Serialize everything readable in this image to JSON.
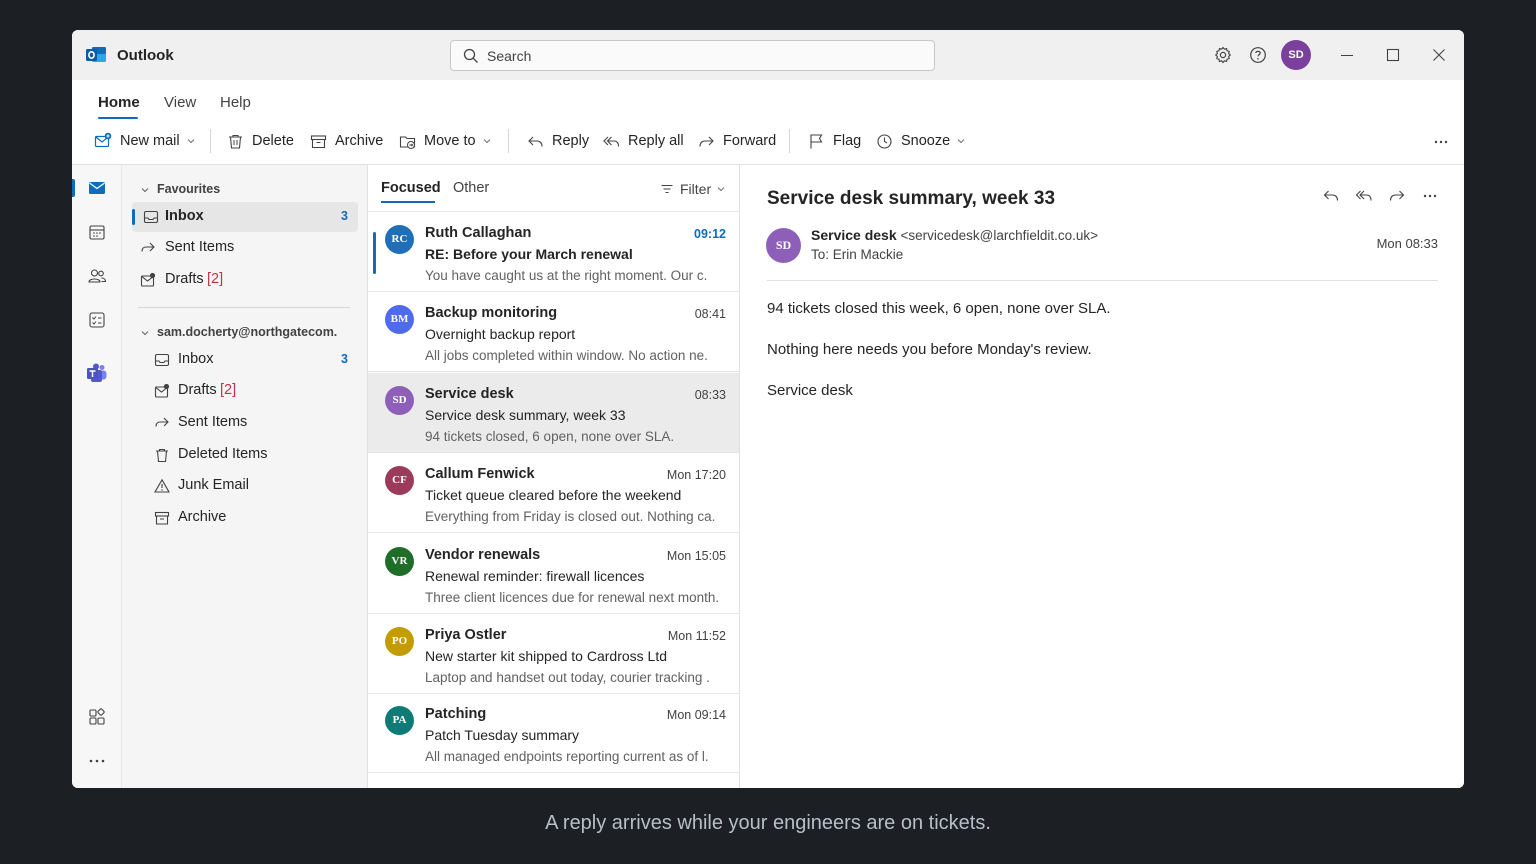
{
  "app": {
    "title": "Outlook",
    "brand_color": "#0f6cbd"
  },
  "search": {
    "placeholder": "Search"
  },
  "titlebar": {
    "avatar_initials": "SD",
    "avatar_color": "#7b3f9e"
  },
  "ribbon": {
    "tabs": [
      {
        "label": "Home",
        "active": true
      },
      {
        "label": "View"
      },
      {
        "label": "Help"
      }
    ],
    "commands": {
      "new_mail": "New mail",
      "delete": "Delete",
      "archive": "Archive",
      "move_to": "Move to",
      "reply": "Reply",
      "reply_all": "Reply all",
      "forward": "Forward",
      "flag": "Flag",
      "snooze": "Snooze"
    }
  },
  "rail": {
    "items": [
      "mail-icon",
      "calendar-icon",
      "people-icon",
      "tasks-icon",
      "teams-icon",
      "apps-icon",
      "more-icon"
    ]
  },
  "folders": {
    "favourites_label": "Favourites",
    "favourites": [
      {
        "label": "Inbox",
        "count": "3",
        "selected": true
      },
      {
        "label": "Sent Items"
      },
      {
        "label": "Drafts",
        "count": "[2]"
      }
    ],
    "account_label": "sam.docherty@northgatecom.",
    "account_folders": [
      {
        "label": "Inbox",
        "count": "3"
      },
      {
        "label": "Drafts",
        "count": "[2]"
      },
      {
        "label": "Sent Items"
      },
      {
        "label": "Deleted Items"
      },
      {
        "label": "Junk Email"
      },
      {
        "label": "Archive"
      }
    ]
  },
  "message_list": {
    "tabs": [
      {
        "label": "Focused",
        "active": true
      },
      {
        "label": "Other"
      }
    ],
    "filter_label": "Filter",
    "messages": [
      {
        "initials": "RC",
        "color": "#1f6fb8",
        "from": "Ruth Callaghan",
        "time": "09:12",
        "subject": "RE: Before your March renewal",
        "preview": "You have caught us at the right moment. Our c.",
        "unread": true
      },
      {
        "initials": "BM",
        "color": "#4f6bed",
        "from": "Backup monitoring",
        "time": "08:41",
        "subject": "Overnight backup report",
        "preview": "All jobs completed within window. No action ne."
      },
      {
        "initials": "SD",
        "color": "#8e5fb8",
        "from": "Service desk",
        "time": "08:33",
        "subject": "Service desk summary, week 33",
        "preview": "94 tickets closed, 6 open, none over SLA.",
        "selected": true
      },
      {
        "initials": "CF",
        "color": "#9b3a5a",
        "from": "Callum Fenwick",
        "time": "Mon 17:20",
        "subject": "Ticket queue cleared before the weekend",
        "preview": "Everything from Friday is closed out. Nothing ca."
      },
      {
        "initials": "VR",
        "color": "#1e6e2a",
        "from": "Vendor renewals",
        "time": "Mon 15:05",
        "subject": "Renewal reminder: firewall licences",
        "preview": "Three client licences due for renewal next month."
      },
      {
        "initials": "PO",
        "color": "#c29c00",
        "from": "Priya Ostler",
        "time": "Mon 11:52",
        "subject": "New starter kit shipped to Cardross Ltd",
        "preview": "Laptop and handset out today, courier tracking ."
      },
      {
        "initials": "PA",
        "color": "#0f7b77",
        "from": "Patching",
        "time": "Mon 09:14",
        "subject": "Patch Tuesday summary",
        "preview": "All managed endpoints reporting current as of l."
      }
    ]
  },
  "reading": {
    "subject": "Service desk summary, week 33",
    "sender_initials": "SD",
    "sender_name": "Service desk",
    "sender_address": "<servicedesk@larchfieldit.co.uk>",
    "to": "To: Erin Mackie",
    "time": "Mon 08:33",
    "body": [
      "94 tickets closed this week, 6 open, none over SLA.",
      "Nothing here needs you before Monday's review.",
      "Service desk"
    ]
  },
  "caption": "A reply arrives while your engineers are on tickets."
}
